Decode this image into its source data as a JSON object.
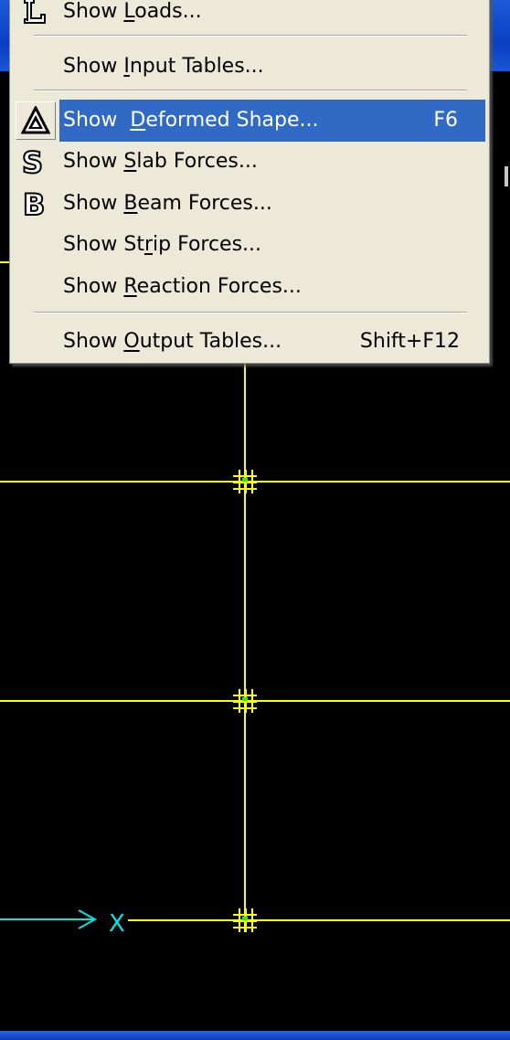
{
  "menu": {
    "items": [
      {
        "label_pre": "Show ",
        "mnemonic": "L",
        "label_post": "oads...",
        "shortcut": "",
        "icon": "l-letter-icon"
      },
      {
        "label_pre": "Show ",
        "mnemonic": "I",
        "label_post": "nput Tables...",
        "shortcut": ""
      },
      {
        "label_pre": "Show  ",
        "mnemonic": "D",
        "label_post": "eformed Shape...",
        "shortcut": "F6",
        "icon": "deformed-shape-icon",
        "highlighted": true
      },
      {
        "label_pre": "Show ",
        "mnemonic": "S",
        "label_post": "lab Forces...",
        "shortcut": "",
        "icon": "s-letter-icon"
      },
      {
        "label_pre": "Show ",
        "mnemonic": "B",
        "label_post": "eam Forces...",
        "shortcut": "",
        "icon": "b-letter-icon"
      },
      {
        "label_pre": "Show St",
        "mnemonic": "r",
        "label_post": "ip Forces...",
        "shortcut": ""
      },
      {
        "label_pre": "Show ",
        "mnemonic": "R",
        "label_post": "eaction Forces...",
        "shortcut": ""
      },
      {
        "label_pre": "Show ",
        "mnemonic": "O",
        "label_post": "utput Tables...",
        "shortcut": "Shift+F12"
      }
    ]
  },
  "model_view": {
    "line_color": "#ffff00",
    "node_color": "#ffff00",
    "axis_color": "#00e5e5",
    "axis_label": "X",
    "background": "#000000"
  },
  "colors": {
    "menu_bg": "#ece9d8",
    "highlight": "#316ac5",
    "titlebar": "#0a3fc4"
  }
}
